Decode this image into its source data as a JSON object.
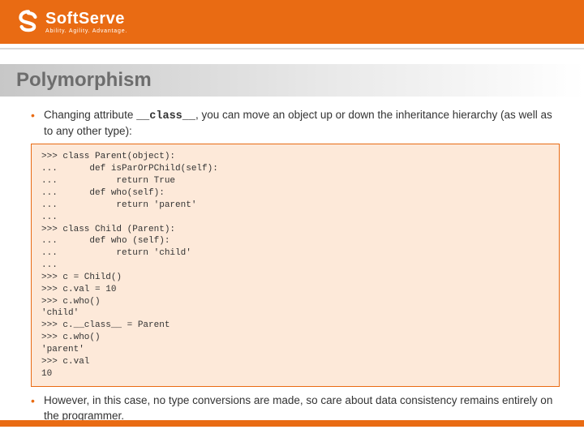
{
  "logo": {
    "name": "SoftServe",
    "tagline": "Ability. Agility. Advantage."
  },
  "title": "Polymorphism",
  "bullet1_pre": "Changing attribute ",
  "bullet1_code": "__class__",
  "bullet1_post": ", you can move an object up or down the inheritance hierarchy (as well as to any other type):",
  "code": ">>> class Parent(object):\n...      def isParOrPChild(self):\n...           return True\n...      def who(self):\n...           return 'parent'\n...\n>>> class Child (Parent):\n...      def who (self):\n...           return 'child'\n...\n>>> c = Child()\n>>> c.val = 10\n>>> c.who()\n'child'\n>>> c.__class__ = Parent\n>>> c.who()\n'parent'\n>>> c.val\n10",
  "bullet2": "However, in this case, no type conversions are made, so care about data consistency remains entirely on the programmer."
}
